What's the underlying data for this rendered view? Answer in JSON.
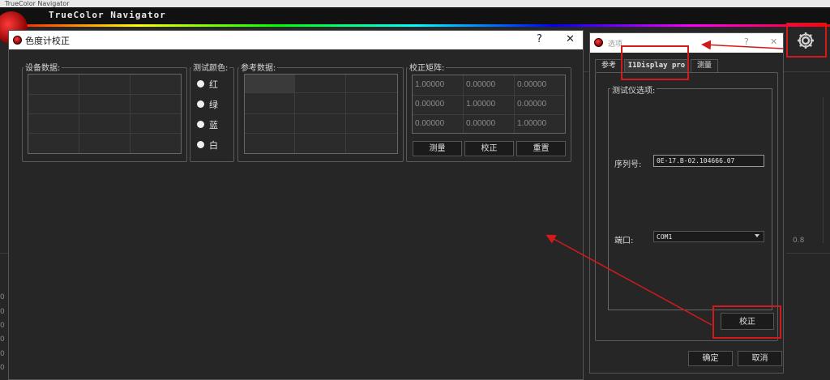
{
  "app": {
    "window_title": "TrueColor Navigator",
    "header_title": "TrueColor Navigator",
    "bg_values": [
      "0.8",
      "0",
      "0",
      "0",
      "0",
      "0",
      "0"
    ]
  },
  "calibration_dialog": {
    "title": "色度计校正",
    "help_label": "?",
    "close_label": "✕",
    "device_data_label": "设备数据:",
    "test_color_label": "测试颜色:",
    "colors": [
      "红",
      "绿",
      "蓝",
      "白"
    ],
    "reference_data_label": "参考数据:",
    "matrix_label": "校正矩阵:",
    "matrix": [
      [
        "1.00000",
        "0.00000",
        "0.00000"
      ],
      [
        "0.00000",
        "1.00000",
        "0.00000"
      ],
      [
        "0.00000",
        "0.00000",
        "1.00000"
      ]
    ],
    "measure_button": "测量",
    "calibrate_button": "校正",
    "reset_button": "重置"
  },
  "options_dialog": {
    "title": "选项",
    "help_label": "?",
    "close_label": "✕",
    "tabs": [
      "参考",
      "I1Display pro",
      "测量"
    ],
    "group_label": "测试仪选项:",
    "serial_label": "序列号:",
    "serial_value": "0E-17.B-02.104666.07",
    "port_label": "端口:",
    "port_value": "COM1",
    "calibrate_button": "校正",
    "ok_button": "确定",
    "cancel_button": "取消"
  },
  "colors": {
    "annotation_red": "#d21a1a",
    "dialog_bg": "#262626"
  }
}
